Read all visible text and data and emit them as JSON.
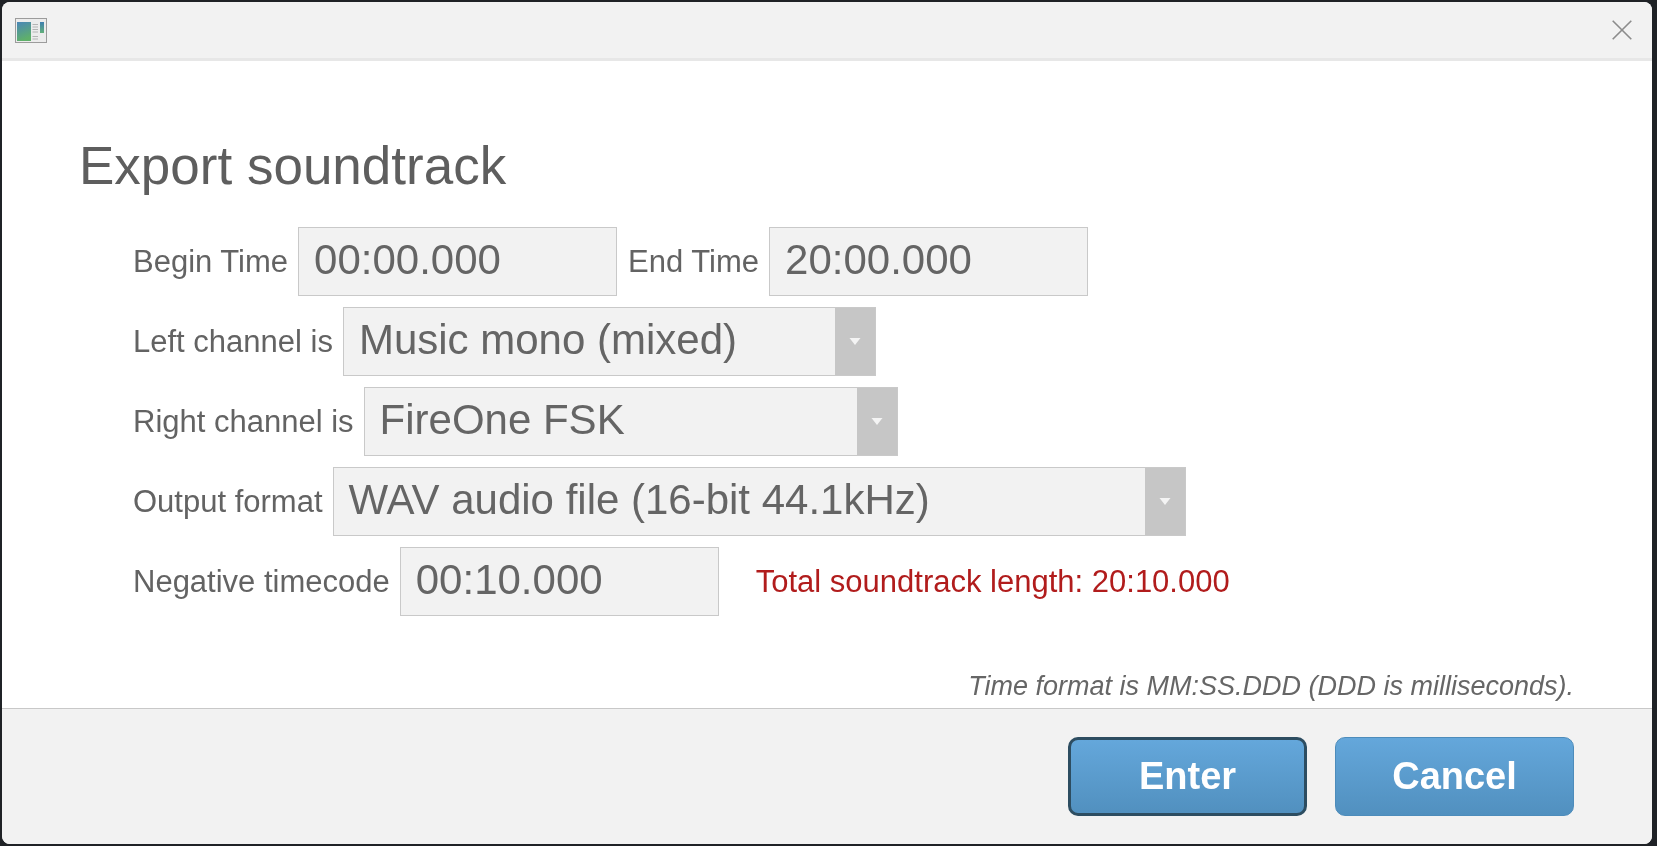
{
  "dialog": {
    "heading": "Export soundtrack",
    "rows": [
      {
        "fields": [
          {
            "label": "Begin Time",
            "kind": "text",
            "value": "00:00.000"
          },
          {
            "label": "End Time",
            "kind": "text",
            "value": "20:00.000"
          }
        ]
      },
      {
        "fields": [
          {
            "label": "Left channel is",
            "kind": "dropdown",
            "value": "Music mono (mixed)"
          }
        ]
      },
      {
        "fields": [
          {
            "label": "Right channel is",
            "kind": "dropdown",
            "value": "FireOne FSK"
          }
        ]
      },
      {
        "fields": [
          {
            "label": "Output format",
            "kind": "dropdown",
            "value": "WAV audio file (16-bit 44.1kHz)"
          }
        ]
      },
      {
        "fields": [
          {
            "label": "Negative timecode",
            "kind": "text",
            "value": "00:10.000"
          }
        ],
        "note": "Total soundtrack length: 20:10.000"
      }
    ],
    "hint": "Time format is MM:SS.DDD (DDD is milliseconds)."
  },
  "buttons": [
    {
      "label": "Enter",
      "focused": true
    },
    {
      "label": "Cancel",
      "focused": false
    }
  ]
}
